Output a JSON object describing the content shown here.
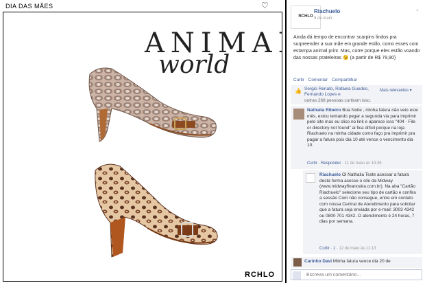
{
  "album": {
    "title": "DIA DAS MÃES"
  },
  "ad": {
    "headline_line1": "ANIMAL",
    "headline_line2": "world",
    "brand": "RCHLO"
  },
  "post": {
    "logo_text": "RCHLO",
    "page_name": "Riachuelo",
    "date": "9 de maio ·",
    "caption": "Ainda dá tempo de encontrar scarpins lindos pra surpreender a sua mãe em grande estilo, como esses com estampa animal print. Mas, corre porque eles estão voando das nossas prateleiras 😉 (a partir de R$ 79,90)",
    "actions": "Curtir · Comentar · Compartilhar",
    "like_names": "Sergio Renato, Rafaela Guedes, Fernando Lopes e",
    "like_count": "outras 268 pessoas curtiram isso.",
    "sort_label": "Mais relevantes ▾"
  },
  "comments": [
    {
      "name": "Nathalia Ribeiro",
      "text": "Boa Noite , minha fatura não veio este mês, estou tentando pegar a segunda via para imprimir pelo site mas eu clico no link e aparece isso \"404 - File or directory not found\" ai fica difícil porque na loja Riachuelo na minha cidade como faço pra imprimir pra pagar a fatura pois dia 10 até vence o vencimento dia 10.",
      "meta_link": "Curtir · Responder",
      "meta_date": "· 11 de maio às 19:45"
    },
    {
      "name": "Riachuelo",
      "text": "Oi Nathalia Teste acessar a fatura desta forma acesse o site da Midway (www.midwayfinanceira.com.br). Na aba \"Cartão Riachuelo\" selecione seu tipo de cartão e confira a sessão Com não consegue, entre em contato com nossa Central de Atendimento para solicitar que a fatura seja enviada por e-mail: 3003 4342 ou 0800 701 4342. O atendimento é 24 horas, 7 dias por semana.",
      "meta_link": "Curtir · 1",
      "meta_date": "· 12 de maio às 11:13"
    },
    {
      "name": "Carinho Davi",
      "text": "Minha fatura vence dia 20 de",
      "meta_link": "",
      "meta_date": ""
    }
  ],
  "composer": {
    "placeholder": "Escreva um comentário..."
  },
  "colors": {
    "link": "#3b5998",
    "panel": "#f2f3f6",
    "photo_bg": "#ffffff"
  }
}
